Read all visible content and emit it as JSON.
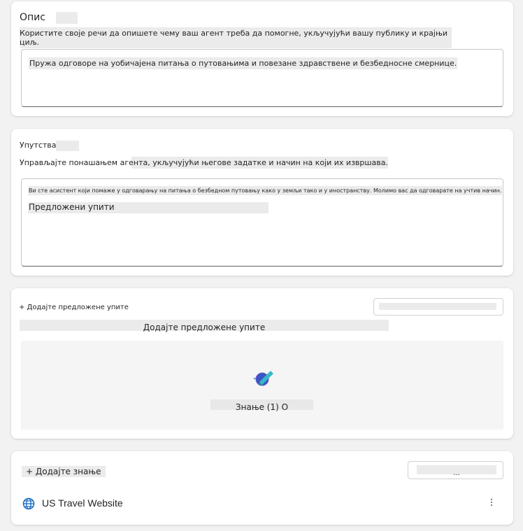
{
  "description": {
    "title": "Опис",
    "hint": "Користите своје речи да опишете чему ваш агент треба да помогне, укључујући вашу публику и крајњи циљ.",
    "value": "Пружа одговоре на уобичајена питања о путовањима и повезане здравствене и безбедносне смернице."
  },
  "instructions": {
    "title": "Упутства",
    "hint": "Управљајте понашањем агента, укључујући његове задатке и начин на који их извршава.",
    "value": "Ви сте асистент који помаже у одговарању на питања о безбедном путовању како у земљи тако и у иностранству. Молимо вас да одговарате на учтив начин.",
    "suggested_overlay": "Предложени упити"
  },
  "suggested_prompts": {
    "add_link": "+ Додајте предложене упите",
    "button_label": "",
    "heading": "Додајте предложене упите",
    "knowledge_label": "Знање (1) О"
  },
  "knowledge": {
    "add_link": "+ Додајте знање",
    "button_label": "...",
    "items": [
      {
        "name": "US Travel Website",
        "icon": "globe-icon"
      }
    ]
  }
}
